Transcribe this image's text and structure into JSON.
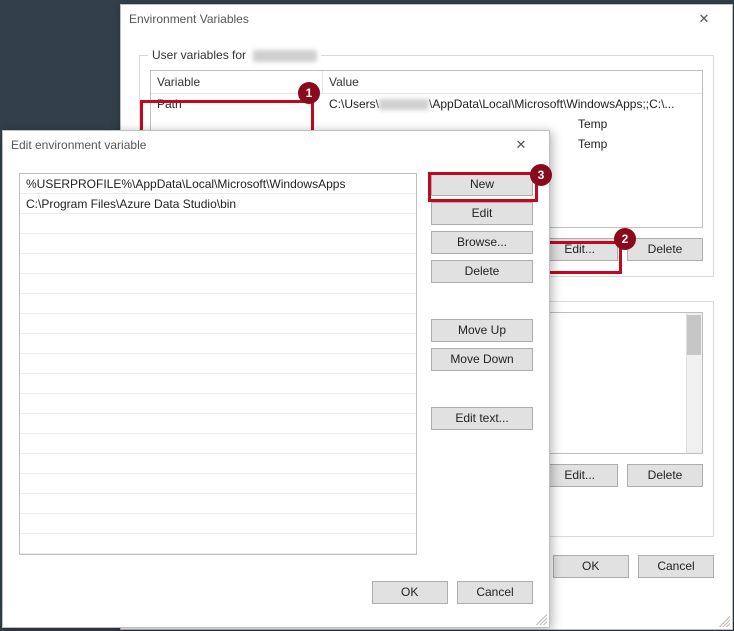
{
  "env_win": {
    "title": "Environment Variables",
    "user_group_label": "User variables for",
    "columns": {
      "variable": "Variable",
      "value": "Value"
    },
    "rows": [
      {
        "variable": "Path",
        "value": "C:\\Users\\████\\AppData\\Local\\Microsoft\\WindowsApps;;C:\\..."
      },
      {
        "variable": "",
        "value": "Temp"
      },
      {
        "variable": "",
        "value": "Temp"
      }
    ],
    "buttons": {
      "edit": "Edit...",
      "delete": "Delete",
      "ok": "OK",
      "cancel": "Cancel"
    }
  },
  "edit_win": {
    "title": "Edit environment variable",
    "entries": [
      "%USERPROFILE%\\AppData\\Local\\Microsoft\\WindowsApps",
      "C:\\Program Files\\Azure Data Studio\\bin"
    ],
    "buttons": {
      "new": "New",
      "edit": "Edit",
      "browse": "Browse...",
      "delete": "Delete",
      "moveup": "Move Up",
      "movedown": "Move Down",
      "edittext": "Edit text...",
      "ok": "OK",
      "cancel": "Cancel"
    }
  },
  "callouts": {
    "one": "1",
    "two": "2",
    "three": "3"
  }
}
